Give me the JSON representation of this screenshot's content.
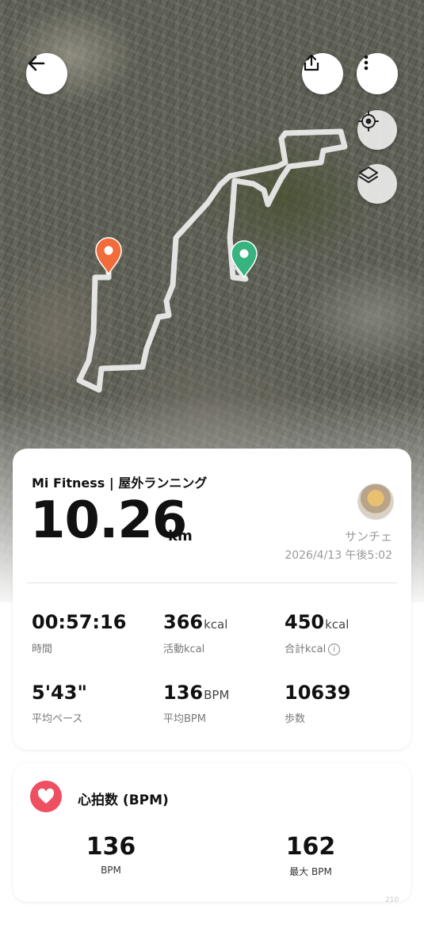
{
  "map": {
    "route_color": "#f2f2f2",
    "start_marker_color": "#36b37e",
    "end_marker_color": "#f26b3a"
  },
  "toolbar": {
    "back_icon": "arrow-left-icon",
    "share_icon": "share-icon",
    "more_icon": "more-vertical-icon",
    "locate_icon": "locate-icon",
    "layers_icon": "layers-icon"
  },
  "summary": {
    "app_title": "Mi Fitness | 屋外ランニング",
    "distance": "10.26",
    "distance_unit": "km",
    "user_name": "サンチェ",
    "datetime": "2026/4/13 午後5:02",
    "stats": [
      {
        "value": "00:57:16",
        "unit": "",
        "label": "時間"
      },
      {
        "value": "366",
        "unit": "kcal",
        "label": "活動kcal"
      },
      {
        "value": "450",
        "unit": "kcal",
        "label": "合計kcal"
      },
      {
        "value": "5'43\"",
        "unit": "",
        "label": "平均ペース"
      },
      {
        "value": "136",
        "unit": "BPM",
        "label": "平均BPM"
      },
      {
        "value": "10639",
        "unit": "",
        "label": "歩数"
      }
    ],
    "info_icon_glyph": "i"
  },
  "heart_rate": {
    "title": "心拍数 (BPM)",
    "icon": "heart-icon",
    "accent_color": "#ee4f61",
    "avg_value": "136",
    "avg_label": "BPM",
    "max_value": "162",
    "max_label": "最大 BPM"
  },
  "footer_number": "210"
}
